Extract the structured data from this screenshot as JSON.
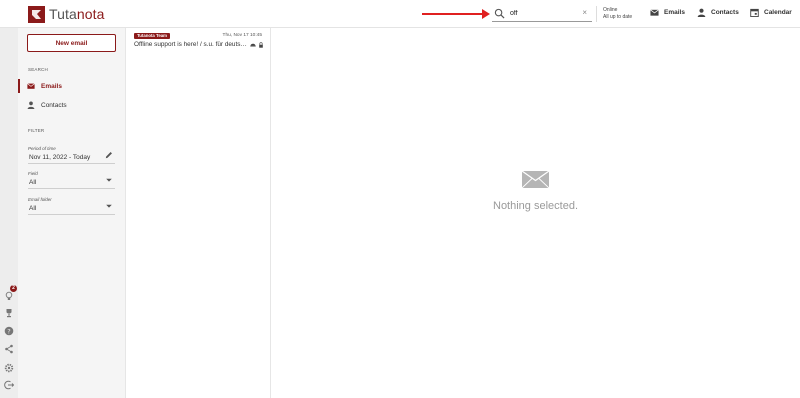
{
  "app": {
    "logo_part1": "Tuta",
    "logo_part2": "nota"
  },
  "colors": {
    "brand": "#8b1a1a",
    "annotation_arrow": "#e02020"
  },
  "search": {
    "value": "off",
    "placeholder": "",
    "clear_glyph": "×"
  },
  "status": {
    "line1": "Online",
    "line2": "All up to date"
  },
  "nav": {
    "emails": "Emails",
    "contacts": "Contacts",
    "calendar": "Calendar"
  },
  "sidebar": {
    "new_email": "New email",
    "search_heading": "SEARCH",
    "items": [
      {
        "label": "Emails",
        "icon": "mail-icon",
        "active": true
      },
      {
        "label": "Contacts",
        "icon": "person-icon",
        "active": false
      }
    ],
    "filter_heading": "FILTER",
    "filters": [
      {
        "label": "Period of time",
        "value": "Nov 11, 2022 - Today",
        "icon": "pencil-icon"
      },
      {
        "label": "Field",
        "value": "All",
        "icon": "dropdown-arrow-icon"
      },
      {
        "label": "Email folder",
        "value": "All",
        "icon": "dropdown-arrow-icon"
      }
    ]
  },
  "rail": {
    "icons": [
      "lightbulb-icon",
      "trophy-icon",
      "help-icon",
      "share-icon",
      "settings-icon",
      "logout-icon"
    ],
    "badge_count": "2"
  },
  "list": {
    "rows": [
      {
        "sender": "Tutanota Team",
        "date": "Thu, Nov 17 10:45",
        "subject": "Offline support is here! / s.u. für deutsche Version",
        "icons": [
          "confidential-icon",
          "lock-icon"
        ]
      }
    ]
  },
  "detail": {
    "empty_message": "Nothing selected."
  }
}
